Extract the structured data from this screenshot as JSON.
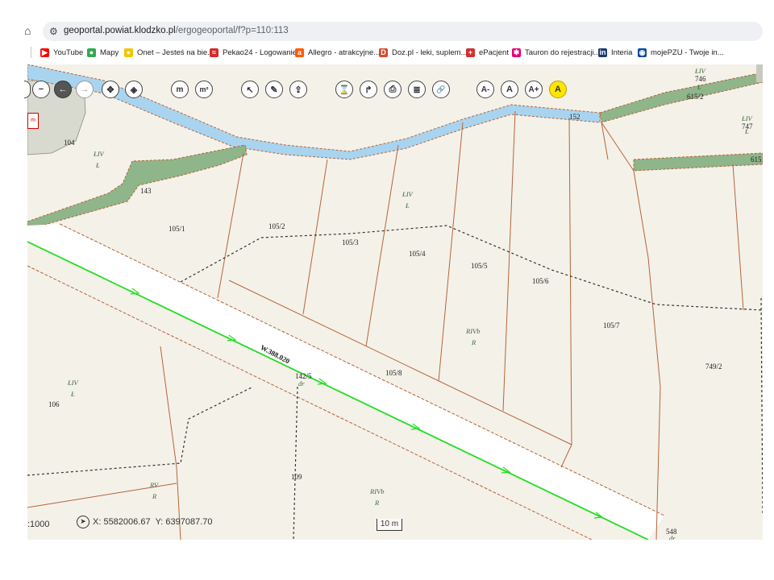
{
  "browser": {
    "url_host": "geoportal.powiat.klodzko.pl",
    "url_path": "/ergogeoportal/f?p=110:113"
  },
  "bookmarks": [
    {
      "label": "YouTube",
      "color": "#ff0000",
      "glyph": "▶"
    },
    {
      "label": "Mapy",
      "color": "#34a853",
      "glyph": "●"
    },
    {
      "label": "Onet – Jesteś na bie...",
      "color": "#f5c400",
      "glyph": "●"
    },
    {
      "label": "Pekao24 - Logowanie",
      "color": "#d42b2b",
      "glyph": "≈"
    },
    {
      "label": "Allegro - atrakcyjne...",
      "color": "#ff5a00",
      "glyph": "a"
    },
    {
      "label": "Doz.pl - leki, suplem...",
      "color": "#d94b2b",
      "glyph": "D"
    },
    {
      "label": "ePacjent",
      "color": "#d32f2f",
      "glyph": "+"
    },
    {
      "label": "Tauron do rejestracji...",
      "color": "#e2007a",
      "glyph": "✱"
    },
    {
      "label": "Interia",
      "color": "#1a3a6b",
      "glyph": "in"
    },
    {
      "label": "mojePZU - Twoje in...",
      "color": "#0a4a9c",
      "glyph": "◉"
    }
  ],
  "toolbar": {
    "zoom_out": "−",
    "pan_left": "←",
    "pan_right": "→",
    "pan": "✥",
    "center": "◈",
    "measure_length": "m",
    "measure_area": "m²",
    "select": "↖",
    "draw": "✎",
    "export": "⇪",
    "history": "⌛",
    "share": "↱",
    "print": "⎙",
    "layers": "≣",
    "link": "🔗",
    "font_smaller": "A-",
    "font_normal": "A",
    "font_larger": "A+",
    "font_highlight": "A"
  },
  "map": {
    "parcels": {
      "p104": "104",
      "p143": "143",
      "p105_1": "105/1",
      "p105_2": "105/2",
      "p105_3": "105/3",
      "p105_4": "105/4",
      "p105_5": "105/5",
      "p105_6": "105/6",
      "p105_7": "105/7",
      "p105_8": "105/8",
      "p152": "152",
      "p615_2": "615/2",
      "p615": "615",
      "p746": "746",
      "p747": "747",
      "p749_2": "749/2",
      "p106": "106",
      "p109": "109",
      "p142_5": "142/5",
      "p548": "548"
    },
    "land_use": {
      "liv_1": "ŁIV",
      "l_1": "Ł",
      "liv_2": "ŁIV",
      "l_2": "Ł",
      "liv_3": "ŁIV",
      "l_3": "Ł",
      "liv_4": "ŁIV",
      "l_4": "Ł",
      "liv_5": "ŁIV",
      "l_5": "Ł",
      "rivb_1": "RIVb",
      "r_1": "R",
      "rivb_2": "RIVb",
      "r_2": "R",
      "rv": "RV",
      "r_3": "R",
      "dr_1": "dr",
      "dr_2": "dr"
    },
    "road_label": "W.388.020",
    "scale": ":1000",
    "coord_x": "X: 5582006.67",
    "coord_y": "Y: 6397087.70",
    "scale_bar": "10 m",
    "legend_btn": "m"
  },
  "colors": {
    "river": "#a8d4f0",
    "green_strip": "#8fb58a",
    "boundary": "#b5653a",
    "road_line": "#22dd22",
    "background": "#f4f1e9"
  }
}
